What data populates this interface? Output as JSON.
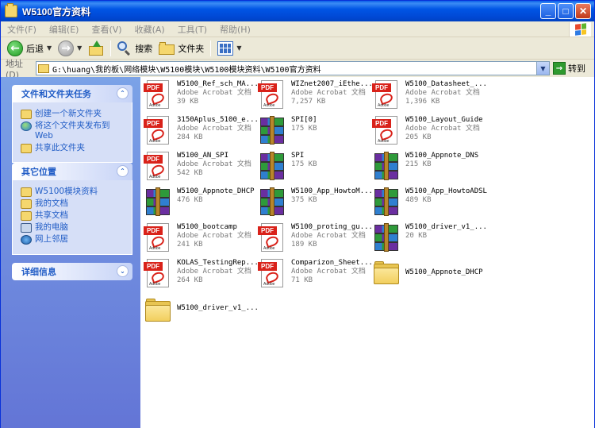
{
  "window": {
    "title": "W5100官方资料"
  },
  "menu": [
    "文件(F)",
    "编辑(E)",
    "查看(V)",
    "收藏(A)",
    "工具(T)",
    "帮助(H)"
  ],
  "toolbar": {
    "back": "后退",
    "search": "搜索",
    "folders": "文件夹"
  },
  "address": {
    "label": "地址(D)",
    "path": "G:\\huang\\我的板\\网络模块\\W5100模块\\W5100模块资料\\W5100官方资料",
    "go": "转到"
  },
  "tasks": {
    "title": "文件和文件夹任务",
    "items": [
      "创建一个新文件夹",
      "将这个文件夹发布到 Web",
      "共享此文件夹"
    ]
  },
  "places": {
    "title": "其它位置",
    "items": [
      "W5100模块资料",
      "我的文档",
      "共享文档",
      "我的电脑",
      "网上邻居"
    ]
  },
  "details": {
    "title": "详细信息"
  },
  "files": [
    {
      "name": "W5100_Ref_sch_MA...",
      "type": "Adobe Acrobat 文档",
      "size": "39 KB",
      "icon": "pdf-icon"
    },
    {
      "name": "WIZnet2007_iEthe...",
      "type": "Adobe Acrobat 文档",
      "size": "7,257 KB",
      "icon": "pdf-icon"
    },
    {
      "name": "W5100_Datasheet_...",
      "type": "Adobe Acrobat 文档",
      "size": "1,396 KB",
      "icon": "pdf-icon"
    },
    {
      "name": "3150Aplus_5100_e...",
      "type": "Adobe Acrobat 文档",
      "size": "284 KB",
      "icon": "pdf-icon"
    },
    {
      "name": "SPI[0]",
      "type": "",
      "size": "175 KB",
      "icon": "rar-icon"
    },
    {
      "name": "W5100_Layout_Guide",
      "type": "Adobe Acrobat 文档",
      "size": "205 KB",
      "icon": "pdf-icon"
    },
    {
      "name": "W5100_AN_SPI",
      "type": "Adobe Acrobat 文档",
      "size": "542 KB",
      "icon": "pdf-icon"
    },
    {
      "name": "SPI",
      "type": "",
      "size": "175 KB",
      "icon": "rar-icon"
    },
    {
      "name": "W5100_Appnote_DNS",
      "type": "",
      "size": "215 KB",
      "icon": "rar-icon"
    },
    {
      "name": "W5100_Appnote_DHCP",
      "type": "",
      "size": "476 KB",
      "icon": "rar-icon"
    },
    {
      "name": "W5100_App_HowtoM...",
      "type": "",
      "size": "375 KB",
      "icon": "rar-icon"
    },
    {
      "name": "W5100_App_HowtoADSL",
      "type": "",
      "size": "489 KB",
      "icon": "rar-icon"
    },
    {
      "name": "W5100_bootcamp",
      "type": "Adobe Acrobat 文档",
      "size": "241 KB",
      "icon": "pdf-icon"
    },
    {
      "name": "W5100_proting_gu...",
      "type": "Adobe Acrobat 文档",
      "size": "189 KB",
      "icon": "pdf-icon"
    },
    {
      "name": "W5100_driver_v1_...",
      "type": "",
      "size": "20 KB",
      "icon": "rar-icon"
    },
    {
      "name": "KOLAS_TestingRep...",
      "type": "Adobe Acrobat 文档",
      "size": "264 KB",
      "icon": "pdf-icon"
    },
    {
      "name": "Comparizon_Sheet...",
      "type": "Adobe Acrobat 文档",
      "size": "71 KB",
      "icon": "pdf-icon"
    },
    {
      "name": "W5100_Appnote_DHCP",
      "type": "",
      "size": "",
      "icon": "folder-icon"
    },
    {
      "name": "W5100_driver_v1_...",
      "type": "",
      "size": "",
      "icon": "folder-icon"
    }
  ]
}
